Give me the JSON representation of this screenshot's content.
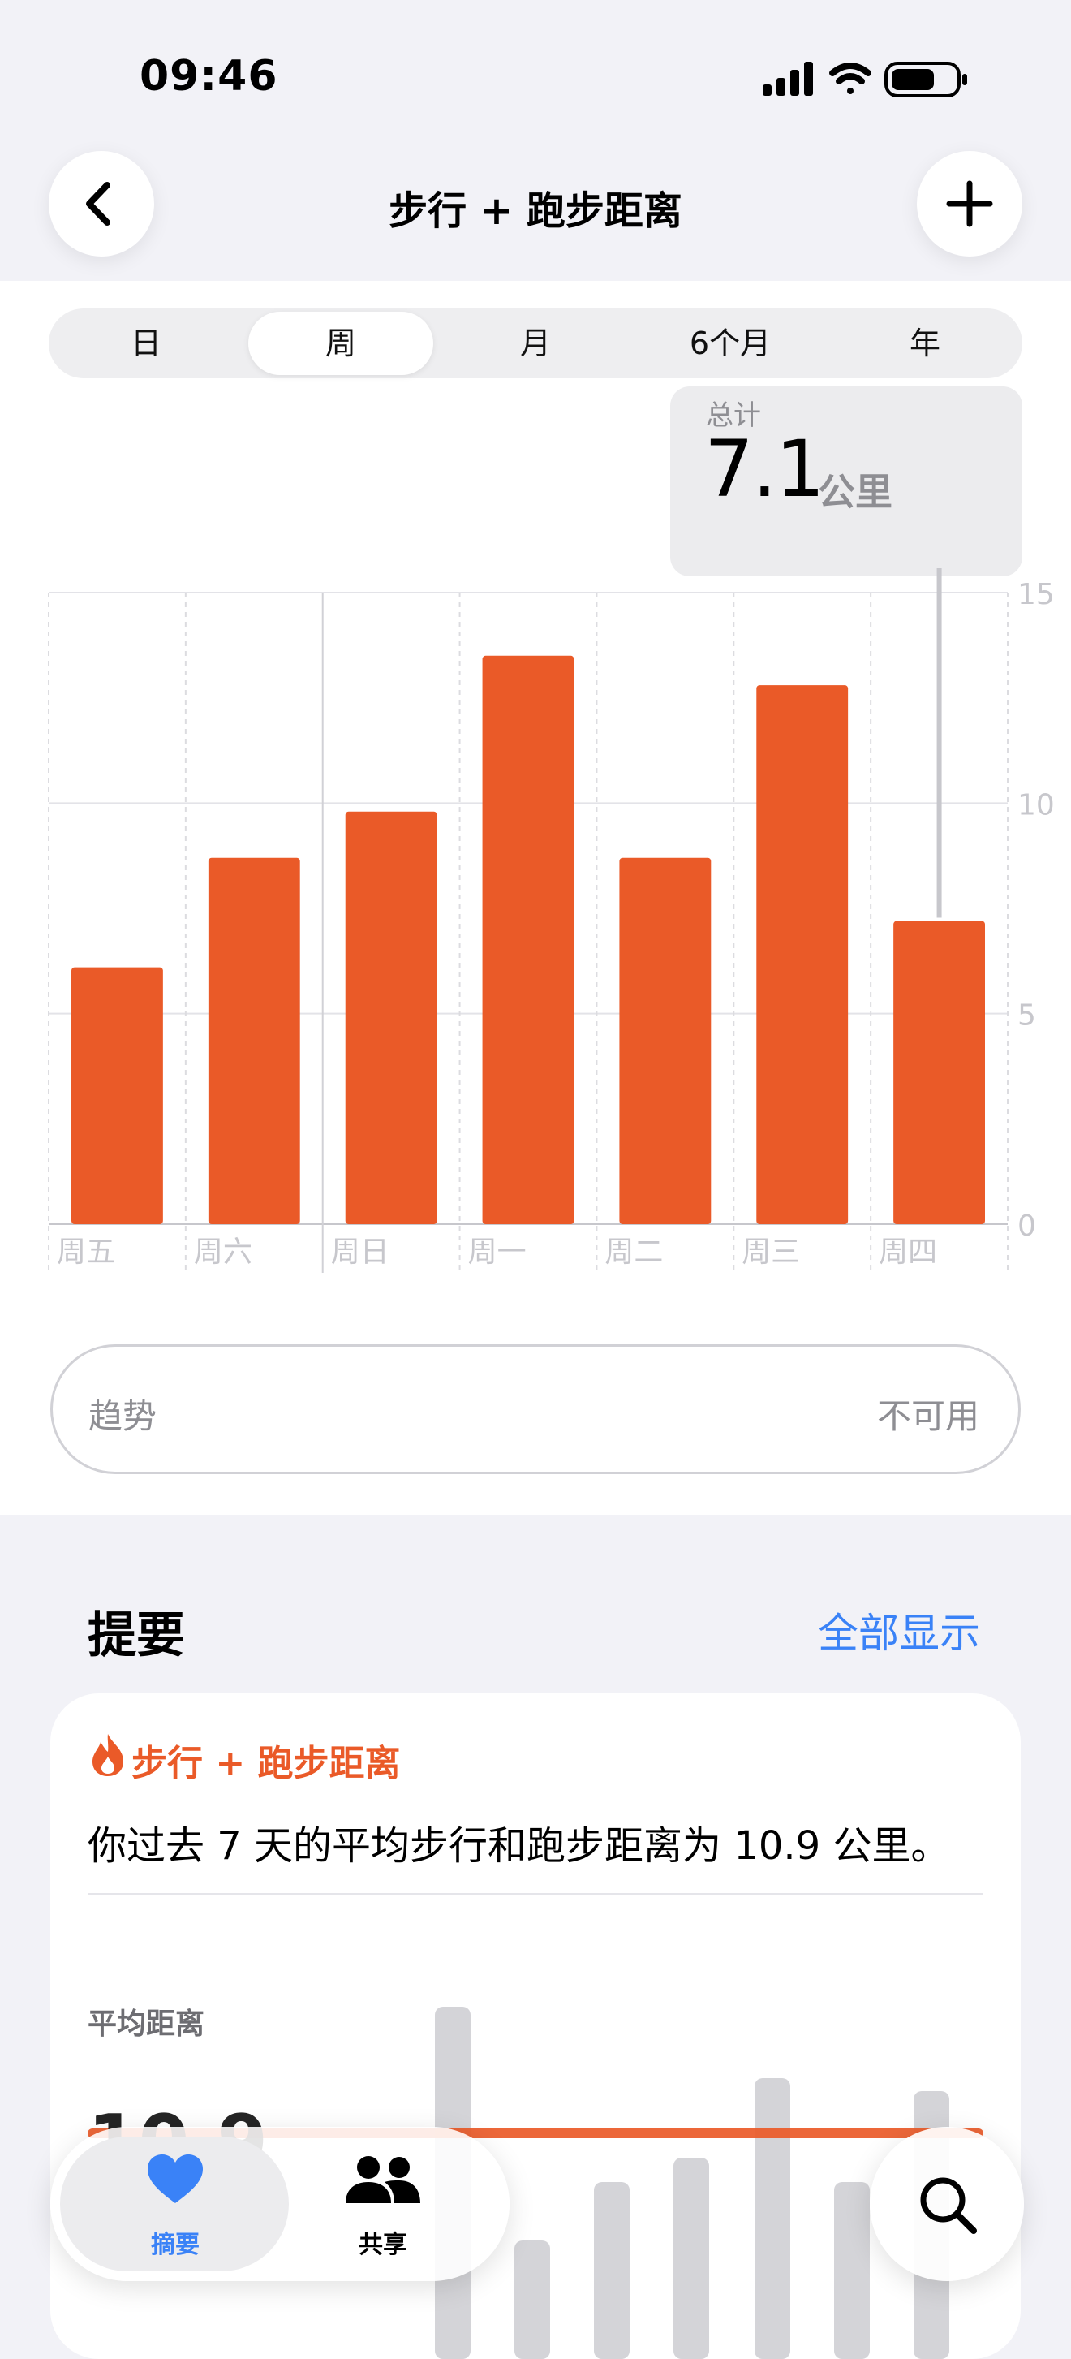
{
  "status_bar": {
    "time": "09:46"
  },
  "nav": {
    "title": "步行 + 跑步距离",
    "back_icon": "chevron-left-icon",
    "add_icon": "plus-icon"
  },
  "segments": {
    "items": [
      "日",
      "周",
      "月",
      "6个月",
      "年"
    ],
    "selected": "周"
  },
  "total": {
    "label": "总计",
    "value": "7.1",
    "unit": "公里"
  },
  "chart_data": {
    "type": "bar",
    "categories": [
      "周五",
      "周六",
      "周日",
      "周一",
      "周二",
      "周三",
      "周四"
    ],
    "values": [
      6.1,
      8.7,
      9.8,
      13.5,
      8.7,
      12.8,
      7.2
    ],
    "ylim": [
      0,
      15
    ],
    "yticks": [
      0,
      5,
      10,
      15
    ],
    "ytick_labels": [
      "0",
      "5",
      "10",
      "15"
    ],
    "bar_color": "#ea5a28",
    "highlighted": "周四",
    "grid": true,
    "axis_position": "right"
  },
  "trend": {
    "label": "趋势",
    "value": "不可用"
  },
  "summary": {
    "title": "提要",
    "show_all": "全部显示",
    "card": {
      "header": "步行 + 跑步距离",
      "icon": "flame-icon",
      "text": "你过去 7 天的平均步行和跑步距离为 10.9 公里。",
      "avg_label": "平均距离",
      "avg_value": "10.9"
    }
  },
  "tabbar": {
    "items": [
      {
        "label": "摘要",
        "icon": "heart-icon",
        "selected": true
      },
      {
        "label": "共享",
        "icon": "people-icon",
        "selected": false
      }
    ],
    "search_icon": "search-icon"
  },
  "colors": {
    "accent": "#ea5a28",
    "link": "#3a82f7",
    "tab_selected": "#3a82f7"
  }
}
